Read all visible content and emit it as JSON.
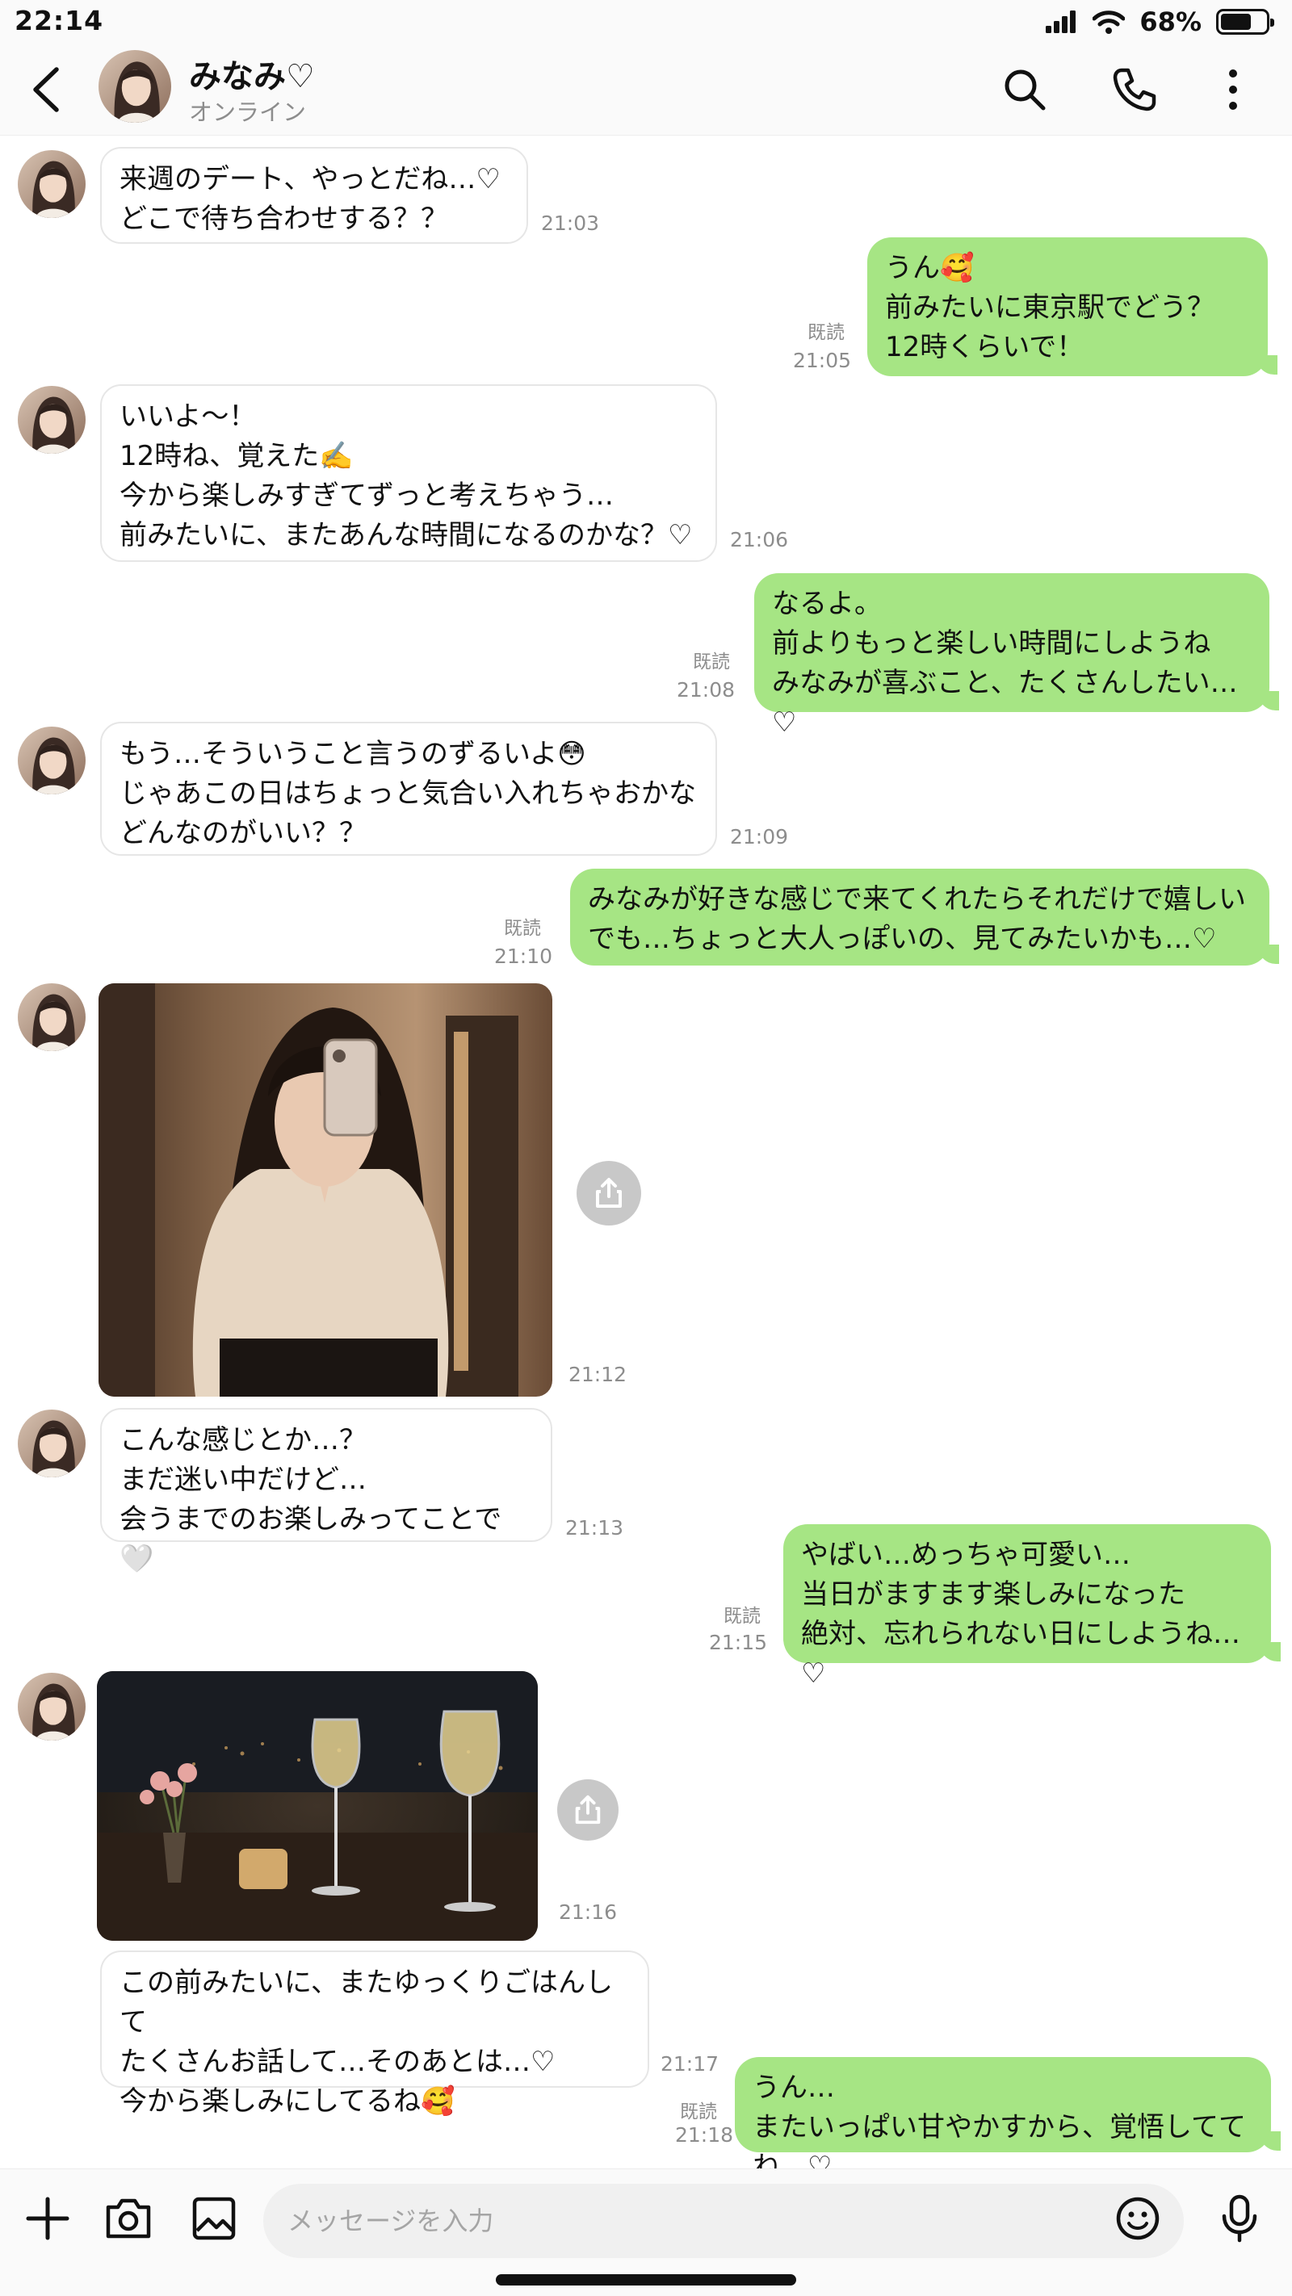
{
  "status_bar": {
    "time": "22:14",
    "battery": "68%",
    "battery_level": 0.68
  },
  "header": {
    "name": "みなみ♡",
    "status": "オンライン"
  },
  "messages": [
    {
      "side": "in",
      "text": "来週のデート、やっとだね…♡\nどこで待ち合わせする？？",
      "time": "21:03"
    },
    {
      "side": "out",
      "text": "うん🥰\n前みたいに東京駅でどう？\n12時くらいで！",
      "time": "21:05",
      "read": "既読"
    },
    {
      "side": "in",
      "text": "いいよ〜！\n12時ね、覚えた✍️\n今から楽しみすぎてずっと考えちゃう…\n前みたいに、またあんな時間になるのかな？♡",
      "time": "21:06"
    },
    {
      "side": "out",
      "text": "なるよ。\n前よりもっと楽しい時間にしようね\nみなみが喜ぶこと、たくさんしたい…♡",
      "time": "21:08",
      "read": "既読"
    },
    {
      "side": "in",
      "text": "もう…そういうこと言うのずるいよ😳\nじゃあこの日はちょっと気合い入れちゃおかな\nどんなのがいい？？",
      "time": "21:09"
    },
    {
      "side": "out",
      "text": "みなみが好きな感じで来てくれたらそれだけで嬉しい\nでも…ちょっと大人っぽいの、見てみたいかも…♡",
      "time": "21:10",
      "read": "既読"
    },
    {
      "side": "in",
      "type": "photo",
      "time": "21:12"
    },
    {
      "side": "in",
      "text": "こんな感じとか…？\nまだ迷い中だけど…\n会うまでのお楽しみってことで🤍",
      "time": "21:13"
    },
    {
      "side": "out",
      "text": "やばい…めっちゃ可愛い…\n当日がますます楽しみになった\n絶対、忘れられない日にしようね…♡",
      "time": "21:15",
      "read": "既読"
    },
    {
      "side": "in",
      "type": "photo",
      "time": "21:16"
    },
    {
      "side": "in",
      "text": "この前みたいに、またゆっくりごはんして\nたくさんお話して…そのあとは…♡\n今から楽しみにしてるね🥰",
      "time": "21:17"
    },
    {
      "side": "out",
      "text": "うん…\nまたいっぱい甘やかすから、覚悟しててね…♡",
      "time": "21:18",
      "read": "既読"
    }
  ],
  "input": {
    "placeholder": "メッセージを入力",
    "value": ""
  },
  "colors": {
    "sent_bubble": "#a6e584",
    "received_bubble": "#ffffff",
    "meta_text": "#8d8d8d"
  },
  "icons": [
    "back-icon",
    "search-icon",
    "phone-icon",
    "more-vertical-icon",
    "share-icon",
    "plus-icon",
    "camera-icon",
    "image-icon",
    "emoji-icon",
    "microphone-icon"
  ]
}
